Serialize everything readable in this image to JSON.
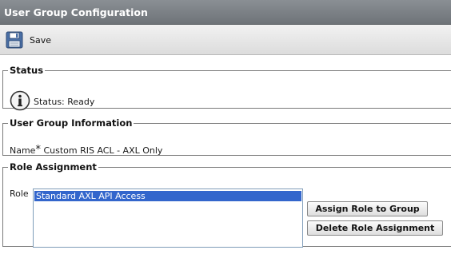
{
  "header": {
    "title": "User Group Configuration"
  },
  "toolbar": {
    "save_label": "Save",
    "save_icon": "floppy-disk-icon"
  },
  "status_section": {
    "legend": "Status",
    "icon": "info-icon",
    "text": "Status: Ready"
  },
  "info_section": {
    "legend": "User Group Information",
    "name_label": "Name",
    "required_marker": "*",
    "name_value": "Custom RIS ACL - AXL Only"
  },
  "role_section": {
    "legend": "Role Assignment",
    "role_label": "Role",
    "roles": [
      "Standard AXL API Access"
    ],
    "selected_role": "Standard AXL API Access",
    "assign_button": "Assign Role to Group",
    "delete_button": "Delete Role Assignment"
  },
  "colors": {
    "title_bar": "#7d8287",
    "selection": "#3366cc",
    "list_border": "#7f9db9"
  }
}
